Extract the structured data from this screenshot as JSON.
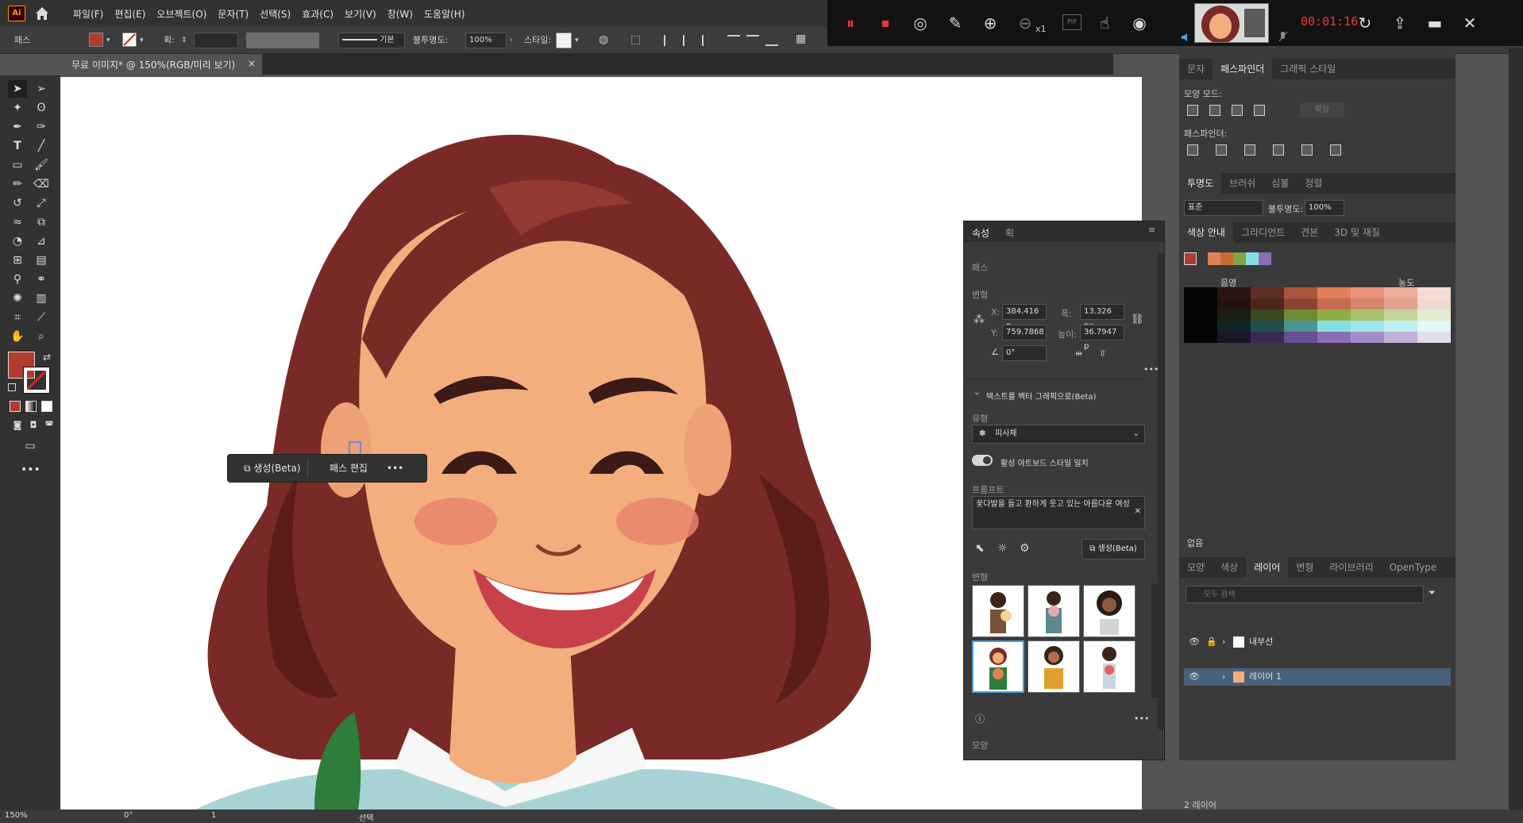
{
  "app": {
    "logo_text": "Ai",
    "menus": [
      "파일(F)",
      "편집(E)",
      "오브젝트(O)",
      "문자(T)",
      "선택(S)",
      "효과(C)",
      "보기(V)",
      "창(W)",
      "도움말(H)"
    ]
  },
  "control_bar": {
    "object_type": "패스",
    "stroke_label": "획:",
    "stroke_style": "기본",
    "opacity_label": "불투명도:",
    "opacity_value": "100%",
    "style_label": "스타일:"
  },
  "recorder": {
    "time": "00:01:16",
    "zoom_label": "x1",
    "pip_label": "PIP"
  },
  "document": {
    "tab_title": "무료 이미지* @ 150%(RGB/미리 보기)",
    "close": "×"
  },
  "context_bar": {
    "generate_label": "생성(Beta)",
    "edit_path_label": "패스 편집",
    "more": "•••"
  },
  "properties": {
    "tabs": [
      "속성",
      "획"
    ],
    "selection": "패스",
    "transform_title": "변형",
    "x_label": "X:",
    "x_value": "384.416 p",
    "y_label": "Y:",
    "y_value": "759.7868",
    "w_label": "폭:",
    "w_value": "13.326 px",
    "h_label": "높이:",
    "h_value": "36.7947 p",
    "angle_value": "0°",
    "text_to_vector_title": "텍스트를 벡터 그래픽으로(Beta)",
    "type_label": "유형",
    "type_value": "피사체",
    "match_style_label": "활성 아트보드 스타일 일치",
    "prompt_label": "프롬프트",
    "prompt_text": "꽃다발을 들고 환하게 웃고 있는 아름다운 여성",
    "generate_label": "생성(Beta)",
    "variations_title": "변형",
    "appearance_title": "모양"
  },
  "pathfinder": {
    "tabs": [
      "문자",
      "패스파인더",
      "그래픽 스타일"
    ],
    "shape_modes_label": "모양 모드:",
    "expand_label": "확장",
    "pathfinders_label": "패스파인더:"
  },
  "transparency": {
    "tabs": [
      "투명도",
      "브러쉬",
      "심볼",
      "정렬"
    ],
    "blend_mode": "표준",
    "opacity_label": "불투명도:",
    "opacity_value": "100%"
  },
  "color_guide": {
    "tabs": [
      "색상 안내",
      "그라디언트",
      "견본",
      "3D 및 재질"
    ],
    "shade_label": "음영",
    "tint_label": "농도",
    "none_label": "없음",
    "grid_rows": [
      [
        "#050505",
        "#2a1410",
        "#5e2f22",
        "#a8573d",
        "#e07f5a",
        "#e8957a",
        "#efae97",
        "#f6ddd3"
      ],
      [
        "#050505",
        "#24120e",
        "#4e251c",
        "#8a4432",
        "#c66a4d",
        "#d4856d",
        "#e0a391",
        "#eedad2"
      ],
      [
        "#050505",
        "#1a200f",
        "#3a4a20",
        "#6d8a34",
        "#90ad45",
        "#a8c06c",
        "#c3d59a",
        "#e3ebd2"
      ],
      [
        "#050505",
        "#0f2525",
        "#244e4e",
        "#4a9596",
        "#86e0e2",
        "#9ee8ea",
        "#bdeff0",
        "#e2f7f8"
      ],
      [
        "#050505",
        "#1c1428",
        "#3a2a52",
        "#6a4f92",
        "#8a6db5",
        "#a58cc6",
        "#c2b1d8",
        "#e3dbee"
      ]
    ],
    "harmony": [
      "#e07f5a",
      "#c56d2e",
      "#7fa34a",
      "#86e0e2",
      "#8a6db5"
    ]
  },
  "layers": {
    "tabs": [
      "모양",
      "색상",
      "레이어",
      "변형",
      "라이브러리",
      "OpenType"
    ],
    "search_placeholder": "모두 검색",
    "items": [
      "내부선",
      "레이어 1"
    ],
    "count_label": "2 레이어"
  },
  "status": {
    "zoom": "150%",
    "angle": "0°",
    "artboard": "1",
    "tool": "선택"
  },
  "colors": {
    "fill": "#b23c2f",
    "accent": "#4d9de0",
    "hair": "#7a2a26",
    "skin": "#f4ae7d"
  }
}
